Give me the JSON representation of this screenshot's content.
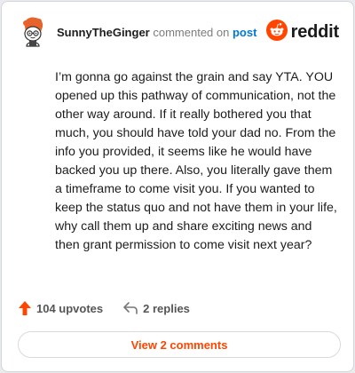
{
  "comment": {
    "author": "SunnyTheGinger",
    "action_text": "commented on",
    "link_text": "post",
    "body": "I’m gonna go against the grain and say YTA. YOU opened up this pathway of communication, not the other way around. If it really bothered you that much, you should have told your dad no. From the info you provided, it seems like he would have backed you up there. Also, you literally gave them a timeframe to come visit you. If you wanted to keep the status quo and not have them in your life, why call them up and share exciting news and then grant permission to come visit next year?",
    "upvotes_label": "104 upvotes",
    "replies_label": "2 replies",
    "view_comments_label": "View 2 comments"
  },
  "brand": {
    "name": "reddit",
    "icon": "reddit-logo-icon",
    "color": "#ff4500"
  },
  "icons": {
    "avatar": "snoo-avatar-icon",
    "upvote": "upvote-arrow-icon",
    "reply": "reply-arrow-icon"
  },
  "colors": {
    "accent": "#ff4500",
    "link": "#0079d3",
    "text": "#1c1c1c"
  }
}
